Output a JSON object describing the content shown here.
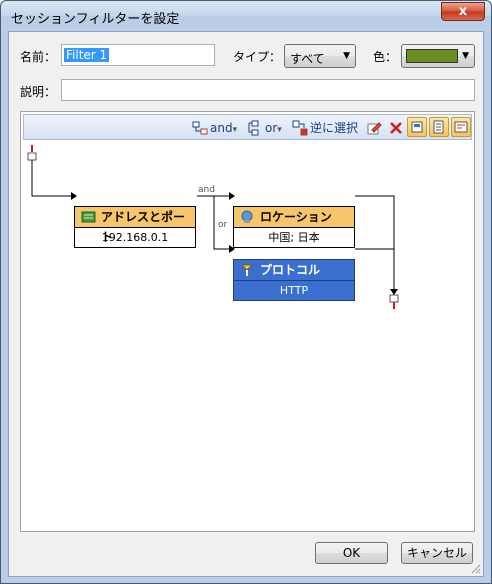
{
  "window": {
    "title": "セッションフィルターを設定",
    "close_label": "x"
  },
  "form": {
    "name_label": "名前：",
    "name_value": "Filter 1",
    "type_label": "タイプ：",
    "type_value": "すべて",
    "color_label": "色：",
    "color_value": "#6b8e23",
    "description_label": "説明：",
    "description_value": ""
  },
  "toolbar": {
    "and_label": "and",
    "or_label": "or",
    "invert_label": "逆に選択",
    "dropdown_arrow": "▾"
  },
  "diagram": {
    "nodes": [
      {
        "title": "アドレスとポート",
        "value": "192.168.0.1"
      },
      {
        "title": "ロケーション",
        "value": "中国; 日本"
      },
      {
        "title": "プロトコル",
        "value": "HTTP"
      }
    ],
    "and_label": "and",
    "or_label": "or"
  },
  "buttons": {
    "ok_label": "OK",
    "cancel_label": "キャンセル"
  }
}
